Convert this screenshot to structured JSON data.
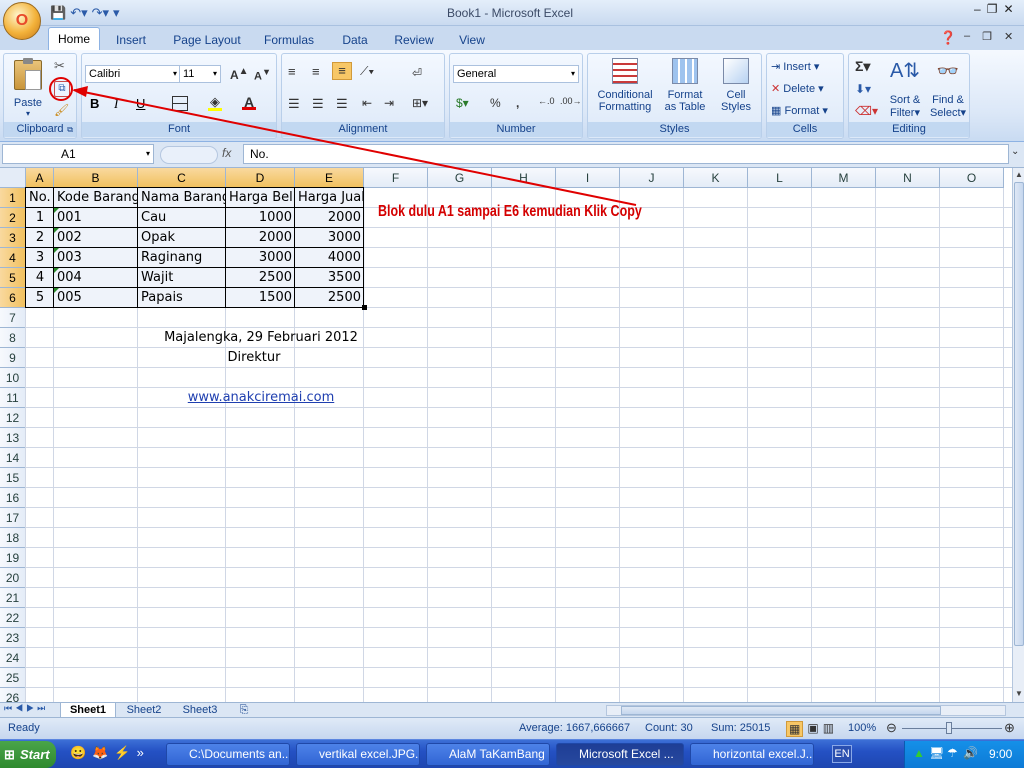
{
  "window": {
    "title": "Book1 - Microsoft Excel",
    "office_button": "O",
    "minimize": "–",
    "restore": "❐",
    "close": "✕"
  },
  "ribbon_tabs": [
    "Home",
    "Insert",
    "Page Layout",
    "Formulas",
    "Data",
    "Review",
    "View"
  ],
  "active_tab": "Home",
  "ribbon": {
    "clipboard": {
      "label": "Clipboard",
      "paste": "Paste"
    },
    "font": {
      "label": "Font",
      "font_name": "Calibri",
      "font_size": "11",
      "bold": "B",
      "italic": "I",
      "underline": "U"
    },
    "alignment": {
      "label": "Alignment"
    },
    "number": {
      "label": "Number",
      "format": "General",
      "percent": "%",
      "comma": ","
    },
    "styles": {
      "label": "Styles",
      "conditional": "Conditional",
      "conditional2": "Formatting",
      "format_table": "Format",
      "format_table2": "as Table",
      "cell_styles": "Cell",
      "cell_styles2": "Styles"
    },
    "cells": {
      "label": "Cells",
      "insert": "Insert",
      "delete": "Delete",
      "format": "Format"
    },
    "editing": {
      "label": "Editing",
      "sum": "Σ",
      "sort": "Sort &",
      "sort2": "Filter",
      "find": "Find &",
      "find2": "Select"
    }
  },
  "formula_bar": {
    "name_box": "A1",
    "fx": "fx",
    "value": "No."
  },
  "columns": [
    "A",
    "B",
    "C",
    "D",
    "E",
    "F",
    "G",
    "H",
    "I",
    "J",
    "K",
    "L",
    "M",
    "N",
    "O"
  ],
  "rows": [
    "1",
    "2",
    "3",
    "4",
    "5",
    "6",
    "7",
    "8",
    "9",
    "10",
    "11",
    "12",
    "13",
    "14",
    "15",
    "16",
    "17",
    "18",
    "19",
    "20",
    "21",
    "22",
    "23",
    "24",
    "25",
    "26"
  ],
  "table": {
    "headers": [
      "No.",
      "Kode Barang",
      "Nama Barang",
      "Harga Beli",
      "Harga Jual"
    ],
    "rows": [
      [
        "1",
        "001",
        "Cau",
        "1000",
        "2000"
      ],
      [
        "2",
        "002",
        "Opak",
        "2000",
        "3000"
      ],
      [
        "3",
        "003",
        "Raginang",
        "3000",
        "4000"
      ],
      [
        "4",
        "004",
        "Wajit",
        "2500",
        "3500"
      ],
      [
        "5",
        "005",
        "Papais",
        "1500",
        "2500"
      ]
    ]
  },
  "footer_text": {
    "place_date": "Majalengka, 29 Februari 2012",
    "position": "Direktur",
    "link": "www.anakciremai.com"
  },
  "annotation": "Blok dulu A1 sampai E6 kemudian Klik Copy",
  "sheets": [
    "Sheet1",
    "Sheet2",
    "Sheet3"
  ],
  "active_sheet": "Sheet1",
  "status": {
    "ready": "Ready",
    "average": "Average: 1667,666667",
    "count": "Count: 30",
    "sum": "Sum: 25015",
    "zoom": "100%"
  },
  "taskbar": {
    "start": "Start",
    "items": [
      "C:\\Documents an...",
      "vertikal excel.JPG...",
      "AlaM TaKamBang ...",
      "Microsoft Excel ...",
      "horizontal excel.J..."
    ],
    "active_item": 3,
    "lang": "EN",
    "clock": "9:00"
  },
  "colors": {
    "accent": "#15428b",
    "selection_header": "#f1c15f",
    "annotation": "#d40000"
  }
}
